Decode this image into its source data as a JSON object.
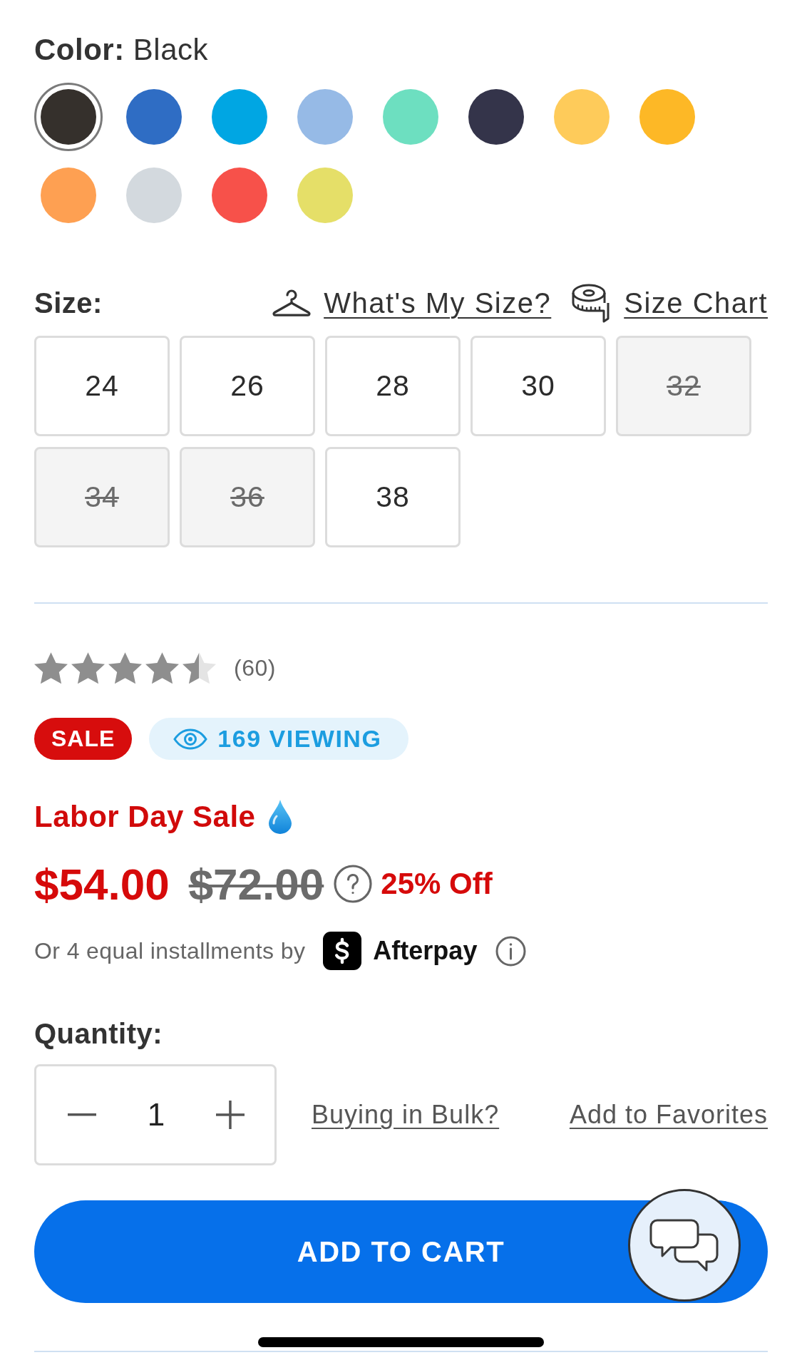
{
  "color": {
    "label": "Color:",
    "value": "Black",
    "swatches": [
      {
        "color": "#35302c",
        "selected": true
      },
      {
        "color": "#2f6dc4",
        "selected": false
      },
      {
        "color": "#00a6e3",
        "selected": false
      },
      {
        "color": "#96bae6",
        "selected": false
      },
      {
        "color": "#6ddfc0",
        "selected": false
      },
      {
        "color": "#34344a",
        "selected": false
      },
      {
        "color": "#fecb5a",
        "selected": false
      },
      {
        "color": "#fdb826",
        "selected": false
      },
      {
        "color": "#fea052",
        "selected": false
      },
      {
        "color": "#d3d9de",
        "selected": false
      },
      {
        "color": "#f7514a",
        "selected": false
      },
      {
        "color": "#e5df68",
        "selected": false
      }
    ]
  },
  "size": {
    "label": "Size:",
    "links": [
      {
        "kind": "hanger",
        "label": "What's My Size?"
      },
      {
        "kind": "tape",
        "label": "Size Chart"
      }
    ],
    "options": [
      {
        "label": "24",
        "disabled": false,
        "selected": false
      },
      {
        "label": "26",
        "disabled": false,
        "selected": false
      },
      {
        "label": "28",
        "disabled": false,
        "selected": false
      },
      {
        "label": "30",
        "disabled": false,
        "selected": false
      },
      {
        "label": "32",
        "disabled": true,
        "selected": false
      },
      {
        "label": "34",
        "disabled": true,
        "selected": false
      },
      {
        "label": "36",
        "disabled": true,
        "selected": false
      },
      {
        "label": "38",
        "disabled": false,
        "selected": false
      }
    ]
  },
  "rating": {
    "stars": 4.5,
    "count": "(60)"
  },
  "badges": [
    {
      "kind": "sale",
      "label": "SALE"
    },
    {
      "kind": "viewing",
      "label": "169 VIEWING"
    }
  ],
  "promo": {
    "label": "Labor Day Sale"
  },
  "price": {
    "current": "$54.00",
    "original": "$72.00",
    "discount": "25% Off"
  },
  "installments": {
    "text": "Or 4 equal installments by",
    "provider": "Afterpay"
  },
  "quantity": {
    "label": "Quantity:",
    "value": "1"
  },
  "links": [
    "Buying in Bulk?",
    "Add to Favorites"
  ],
  "add_to_cart": {
    "label": "ADD TO CART"
  }
}
